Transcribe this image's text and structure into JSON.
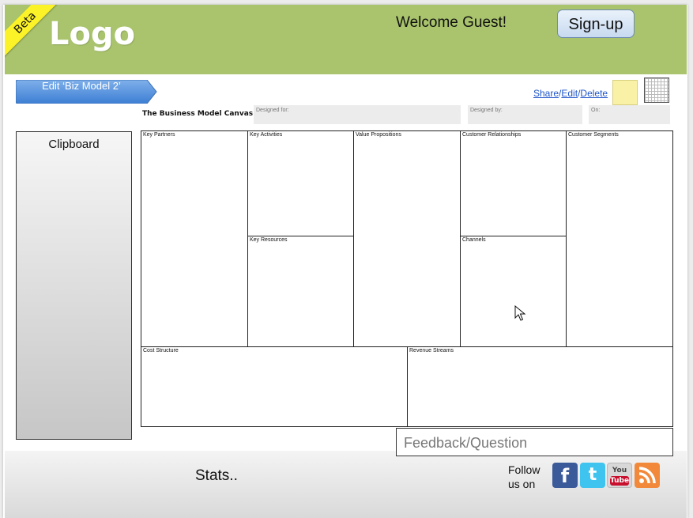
{
  "header": {
    "beta_label": "Beta",
    "logo_text": "Logo",
    "welcome_text": "Welcome Guest!",
    "signup_label": "Sign-up",
    "color": "#a9c46c"
  },
  "toolbar": {
    "edit_label": "Edit ‘Biz Model 2’",
    "share_label": "Share",
    "edit_link_label": "Edit",
    "delete_label": "Delete",
    "separator": "/",
    "icons": [
      "sticky-note-icon",
      "grid-icon"
    ]
  },
  "canvas": {
    "title": "The Business Model Canvas",
    "designed_for_label": "Designed for:",
    "designed_by_label": "Designed by:",
    "on_label": "On:",
    "blocks": {
      "key_partners": "Key Partners",
      "key_activities": "Key Activities",
      "key_resources": "Key Resources",
      "value_propositions": "Value Propositions",
      "customer_relationships": "Customer Relationships",
      "channels": "Channels",
      "customer_segments": "Customer Segments",
      "cost_structure": "Cost Structure",
      "revenue_streams": "Revenue Streams"
    }
  },
  "clipboard": {
    "title": "Clipboard"
  },
  "feedback": {
    "placeholder": "Feedback/Question"
  },
  "footer": {
    "stats_label": "Stats..",
    "follow_line1": "Follow",
    "follow_line2": "us on",
    "social_icons": [
      "facebook-icon",
      "twitter-icon",
      "youtube-icon",
      "rss-icon"
    ],
    "youtube_you": "You",
    "youtube_tube": "Tube"
  }
}
